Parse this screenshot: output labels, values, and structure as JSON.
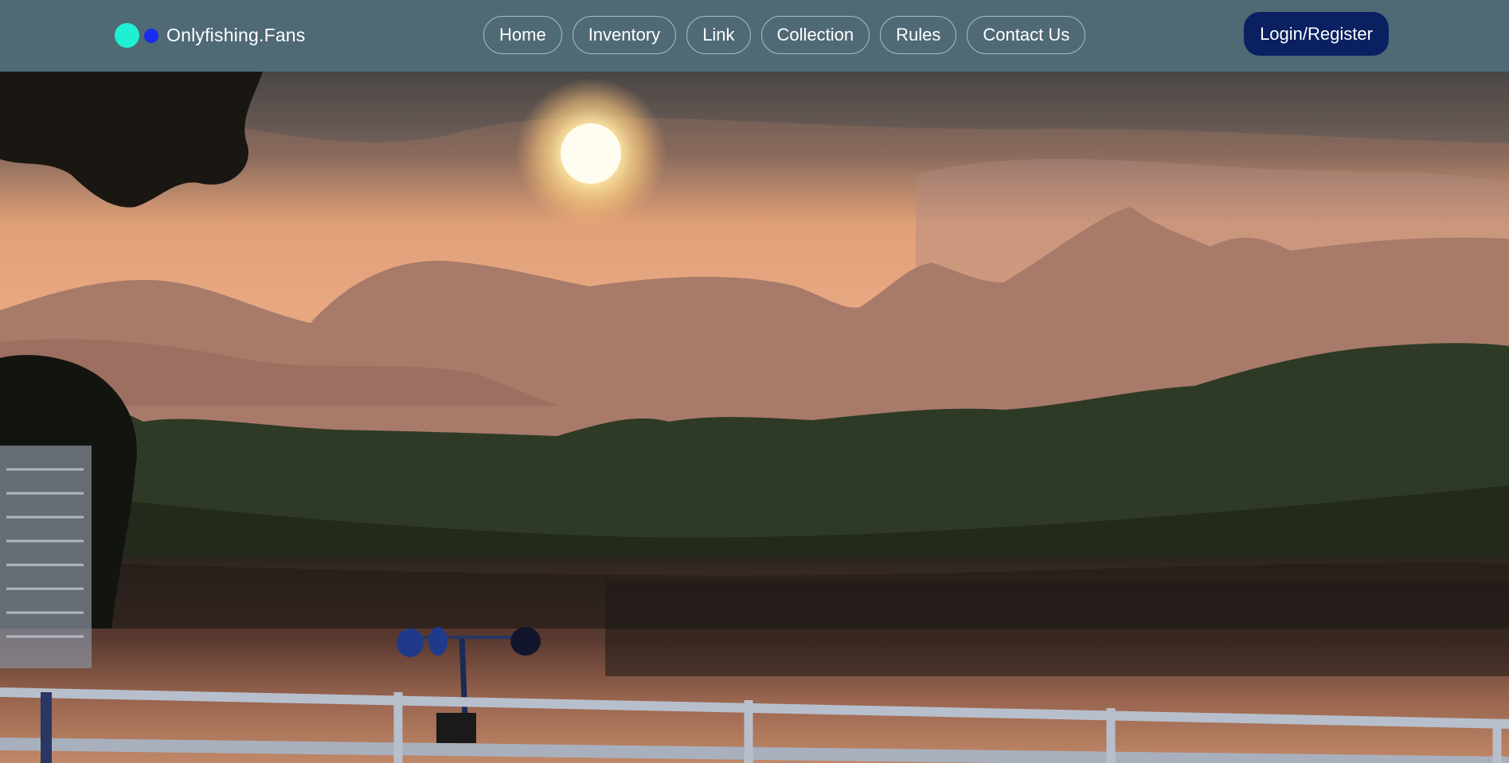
{
  "header": {
    "logo_text": "Onlyfishing.Fans",
    "nav": [
      {
        "label": "Home"
      },
      {
        "label": "Inventory"
      },
      {
        "label": "Link"
      },
      {
        "label": "Collection"
      },
      {
        "label": "Rules"
      },
      {
        "label": "Contact Us"
      }
    ],
    "login_label": "Login/Register"
  },
  "hero": {
    "image_subject": "sunset-over-lake-with-mountains-and-anemometer"
  },
  "colors": {
    "header_bg": "#4f6a75",
    "logo_dot_primary": "#1ff0d2",
    "logo_dot_secondary": "#1a2cf0",
    "login_bg": "#0a2060"
  }
}
